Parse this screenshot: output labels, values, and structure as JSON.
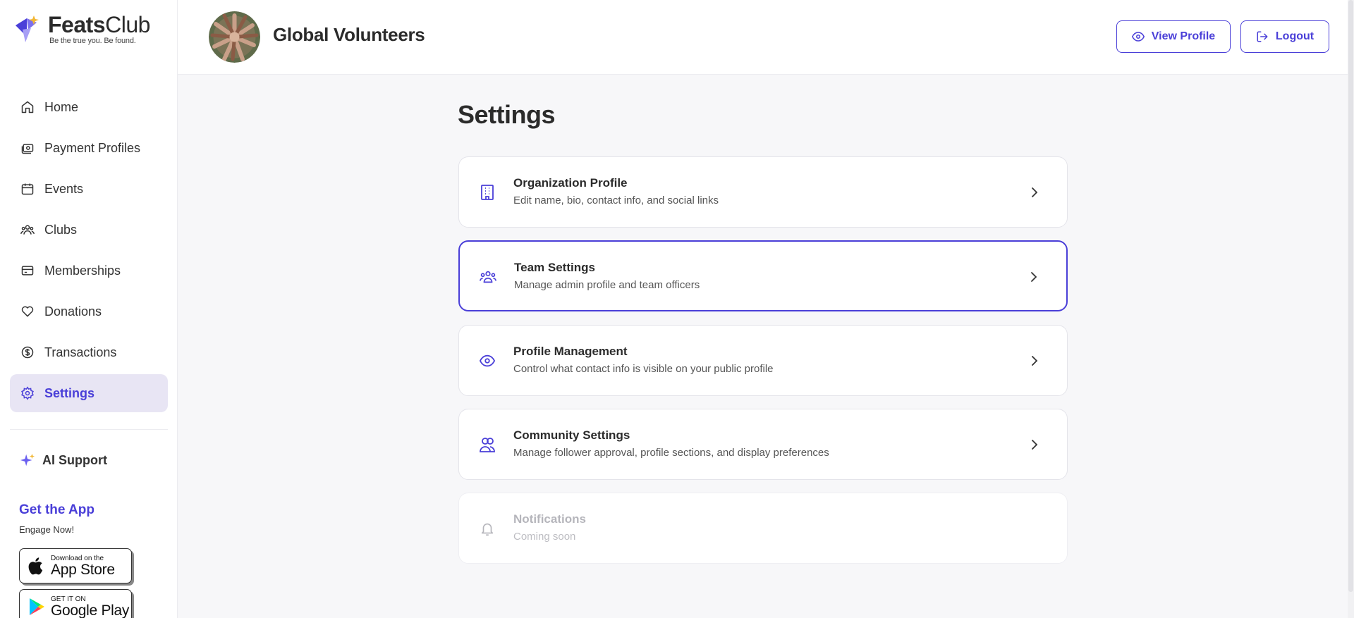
{
  "brand": {
    "name_bold": "Feats",
    "name_regular": "Club",
    "tagline": "Be the true you. Be found.",
    "accent_color": "#4a3fd8"
  },
  "sidebar": {
    "items": [
      {
        "label": "Home",
        "icon": "home-icon"
      },
      {
        "label": "Payment Profiles",
        "icon": "wallet-icon"
      },
      {
        "label": "Events",
        "icon": "calendar-icon"
      },
      {
        "label": "Clubs",
        "icon": "users-icon"
      },
      {
        "label": "Memberships",
        "icon": "card-icon"
      },
      {
        "label": "Donations",
        "icon": "heart-icon"
      },
      {
        "label": "Transactions",
        "icon": "dollar-icon"
      },
      {
        "label": "Settings",
        "icon": "gear-icon",
        "active": true
      }
    ],
    "ai_support": "AI Support",
    "get_app_title": "Get the App",
    "get_app_sub": "Engage Now!",
    "app_store_small": "Download on the",
    "app_store_big": "App Store",
    "google_play_small": "GET IT ON",
    "google_play_big": "Google Play"
  },
  "header": {
    "org_name": "Global Volunteers",
    "view_profile": "View Profile",
    "logout": "Logout"
  },
  "main": {
    "title": "Settings",
    "cards": [
      {
        "title": "Organization Profile",
        "desc": "Edit name, bio, contact info, and social links",
        "icon": "building-icon"
      },
      {
        "title": "Team Settings",
        "desc": "Manage admin profile and team officers",
        "icon": "team-icon",
        "active": true
      },
      {
        "title": "Profile Management",
        "desc": "Control what contact info is visible on your public profile",
        "icon": "eye-icon"
      },
      {
        "title": "Community Settings",
        "desc": "Manage follower approval, profile sections, and display preferences",
        "icon": "community-icon"
      },
      {
        "title": "Notifications",
        "desc": "Coming soon",
        "icon": "bell-icon",
        "disabled": true
      }
    ]
  }
}
